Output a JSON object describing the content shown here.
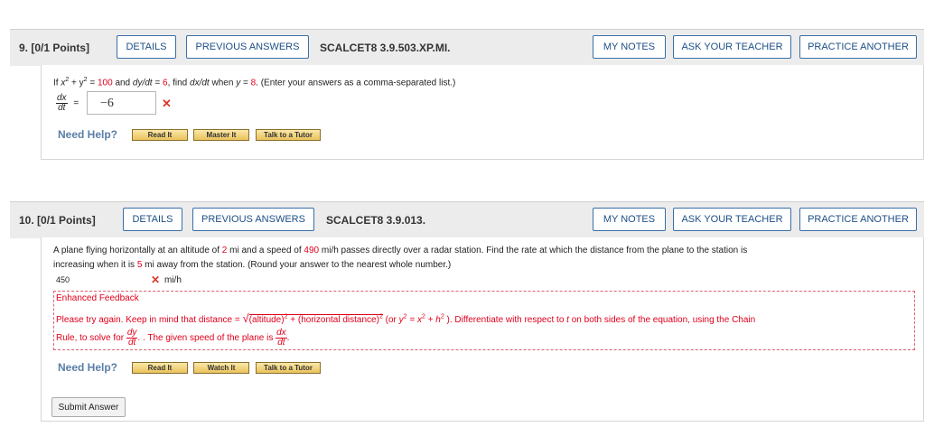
{
  "q9": {
    "number": "9.",
    "points": "[0/1 Points]",
    "details_label": "DETAILS",
    "previous_answers_label": "PREVIOUS ANSWERS",
    "code": "SCALCET8 3.9.503.XP.MI.",
    "my_notes_label": "MY NOTES",
    "ask_teacher_label": "ASK YOUR TEACHER",
    "practice_label": "PRACTICE ANOTHER",
    "prompt_if": "If",
    "eq1": "x",
    "eq2": "+ y",
    "eq3": "=",
    "eq_value": "100",
    "and_text": "and",
    "dydt": "dy/dt",
    "eq4": "=",
    "dydt_value": "6",
    "find_text": ", find",
    "dxdt": "dx/dt",
    "when_text": "when",
    "y_var": "y",
    "eq5": "=",
    "y_value": "8",
    "enter_text": ". (Enter your answers as a comma-separated list.)",
    "frac_num": "dx",
    "frac_den": "dt",
    "frac_eq": "=",
    "answer_value": "−6",
    "need_help": "Need Help?",
    "read_it": "Read It",
    "master_it": "Master It",
    "talk_tutor": "Talk to a Tutor"
  },
  "q10": {
    "number": "10.",
    "points": "[0/1 Points]",
    "details_label": "DETAILS",
    "previous_answers_label": "PREVIOUS ANSWERS",
    "code": "SCALCET8 3.9.013.",
    "my_notes_label": "MY NOTES",
    "ask_teacher_label": "ASK YOUR TEACHER",
    "practice_label": "PRACTICE ANOTHER",
    "p1": "A plane flying horizontally at an altitude of",
    "altitude": "2",
    "p2": "mi and a speed of",
    "speed": "490",
    "p3": "mi/h passes directly over a radar station. Find the rate at which the distance from the plane to the station is",
    "p4": "increasing when it is",
    "distance": "5",
    "p5": "mi away from the station. (Round your answer to the nearest whole number.)",
    "answer_value": "450",
    "unit": "mi/h",
    "feedback_title": "Enhanced Feedback",
    "fb1": "Please try again. Keep in mind that distance =",
    "fb_sqrt": "(altitude)",
    "fb_sqrt2": "+ (horizontal distance)",
    "fb_or": "(or",
    "fb_y": "y",
    "fb_eq": "= x",
    "fb_plus": "+ h",
    "fb2": "). Differentiate with respect to",
    "fb_t": "t",
    "fb3": "on both sides of the equation, using the Chain",
    "fb4": "Rule, to solve for",
    "fb_dy": "dy",
    "fb_dt": "dt",
    "fb5": ". The given speed of the plane is",
    "fb_dx": "dx",
    "fb_dt2": "dt",
    "fb_period": ".",
    "need_help": "Need Help?",
    "read_it": "Read It",
    "watch_it": "Watch It",
    "talk_tutor": "Talk to a Tutor",
    "submit": "Submit Answer"
  }
}
